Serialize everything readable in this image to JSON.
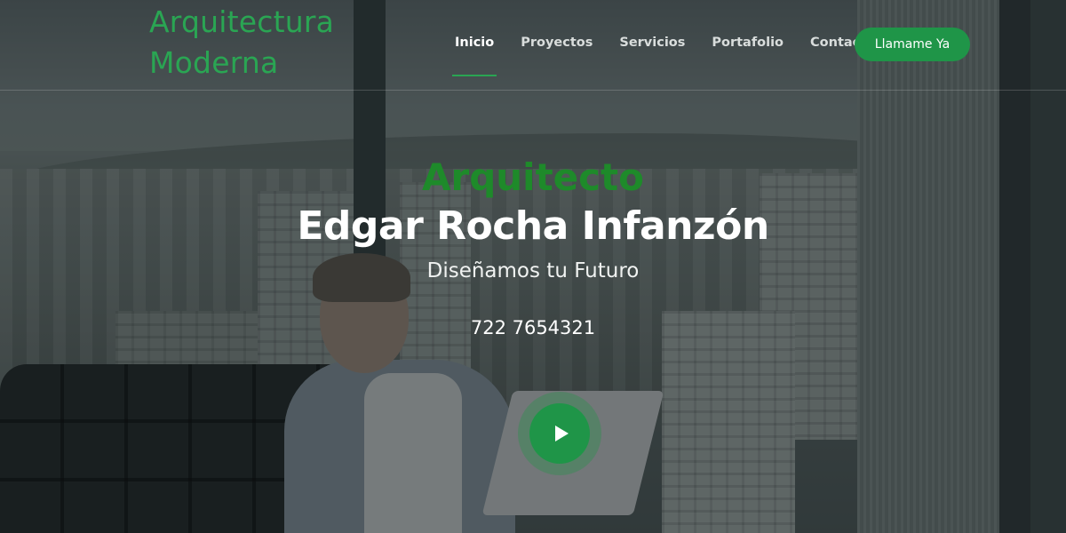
{
  "header": {
    "logo_line1": "Arquitectura",
    "logo_line2": "Moderna",
    "nav": [
      {
        "label": "Inicio",
        "active": true
      },
      {
        "label": "Proyectos",
        "active": false
      },
      {
        "label": "Servicios",
        "active": false
      },
      {
        "label": "Portafolio",
        "active": false
      },
      {
        "label": "Contacto",
        "active": false
      }
    ],
    "cta_label": "Llamame Ya"
  },
  "hero": {
    "subtitle": "Arquitecto",
    "title": "Edgar Rocha Infanzón",
    "tagline": "Diseñamos tu Futuro",
    "phone": "722 7654321",
    "play_icon": "play-icon"
  },
  "colors": {
    "accent": "#1f9548",
    "logo": "#2aa553",
    "subtitle": "#1e8a2a"
  }
}
